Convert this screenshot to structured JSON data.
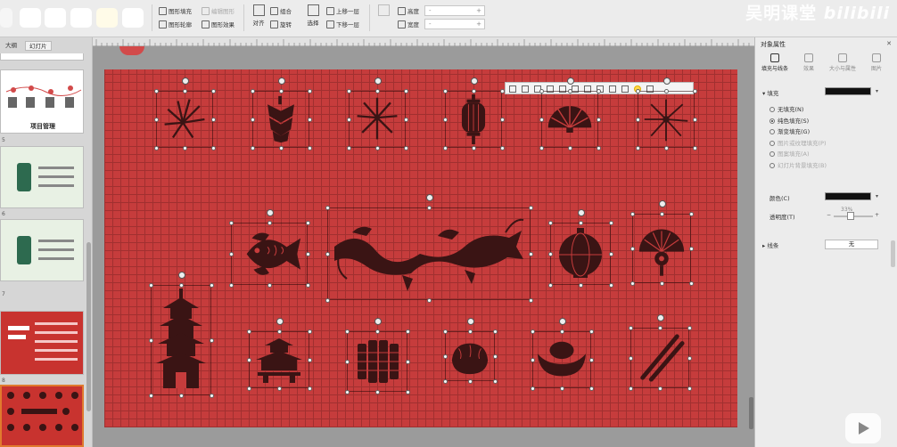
{
  "toolbar": {
    "shape_fill": "图形填充",
    "shape_outline": "图形轮廓",
    "edit_shape": "编辑图形",
    "shape_effects": "图形效果",
    "align": "对齐",
    "group": "组合",
    "rotate": "旋转",
    "select": "选择",
    "bring_forward": "上移一层",
    "send_backward": "下移一层",
    "height_label": "高度",
    "width_label": "宽度",
    "height_value": "-",
    "width_value": "-",
    "spin_plus": "+"
  },
  "watermark": "吴明课堂 bilibili",
  "left_panel": {
    "tabs": [
      "大纲",
      "幻灯片"
    ],
    "slide_numbers": [
      "5",
      "6",
      "7",
      "8",
      "9"
    ],
    "thumb_title": "项目管理"
  },
  "right_panel": {
    "title": "对象属性",
    "tabs": [
      "填充与线条",
      "效果",
      "大小与属性",
      "图片"
    ],
    "fill_section": "填充",
    "fill_options": [
      {
        "label": "无填充(N)",
        "checked": false,
        "disabled": false
      },
      {
        "label": "纯色填充(S)",
        "checked": true,
        "disabled": false
      },
      {
        "label": "渐变填充(G)",
        "checked": false,
        "disabled": false
      },
      {
        "label": "图片或纹理填充(P)",
        "checked": false,
        "disabled": true
      },
      {
        "label": "图案填充(A)",
        "checked": false,
        "disabled": true
      },
      {
        "label": "幻灯片背景填充(B)",
        "checked": false,
        "disabled": true
      }
    ],
    "color_label": "颜色(C)",
    "transparency_label": "透明度(T)",
    "transparency_value": "33%",
    "line_section": "线条",
    "line_value": "无",
    "fill_color": "#111111"
  },
  "colors": {
    "slide_bg": "#c63c3c",
    "icon_fill": "#3a1414",
    "accent": "#d24a4a"
  },
  "icons": [
    "firework-icon",
    "firecracker-string-icon",
    "firework-burst-icon",
    "lantern-icon",
    "folding-fan-icon",
    "firework-sparkle-icon",
    "fish-icon",
    "dragon-icon",
    "round-lantern-icon",
    "round-fan-icon",
    "pagoda-icon",
    "temple-icon",
    "firecracker-bundle-icon",
    "dumpling-icon",
    "gold-ingot-icon",
    "chopsticks-icon"
  ]
}
